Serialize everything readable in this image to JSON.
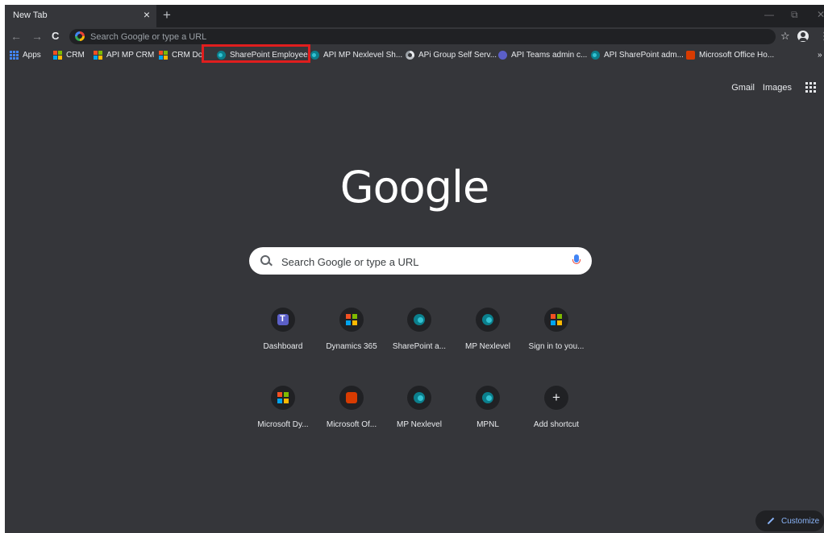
{
  "browser": {
    "tab_title": "New Tab",
    "tab_close": "×",
    "new_tab": "+",
    "nav": {
      "back": "←",
      "forward": "→",
      "reload": "C"
    },
    "omnibox_placeholder": "Search Google or type a URL",
    "star": "☆",
    "menu": "⋮",
    "window": {
      "minimize": "—",
      "restore": "⧉",
      "close": "✕"
    }
  },
  "bookmarks": {
    "items": [
      {
        "label": "Apps",
        "icon": "apps-grid-icon"
      },
      {
        "label": "CRM",
        "icon": "microsoft-icon"
      },
      {
        "label": "API MP CRM",
        "icon": "microsoft-icon"
      },
      {
        "label": "CRM Do",
        "icon": "microsoft-icon"
      },
      {
        "label": "SharePoint Employee",
        "icon": "sharepoint-icon"
      },
      {
        "label": "API MP Nexlevel Sh...",
        "icon": "sharepoint-icon"
      },
      {
        "label": "APi Group Self Serv...",
        "icon": "chrome-icon"
      },
      {
        "label": "API Teams admin c...",
        "icon": "teams-icon"
      },
      {
        "label": "API SharePoint adm...",
        "icon": "sharepoint-icon"
      },
      {
        "label": "Microsoft Office Ho...",
        "icon": "office-icon"
      }
    ],
    "more": "»"
  },
  "header_links": {
    "gmail": "Gmail",
    "images": "Images"
  },
  "logo": "Google",
  "search": {
    "placeholder": "Search Google or type a URL"
  },
  "shortcuts": [
    {
      "label": "Dashboard",
      "icon": "teams-icon"
    },
    {
      "label": "Dynamics 365",
      "icon": "microsoft-icon"
    },
    {
      "label": "SharePoint a...",
      "icon": "sharepoint-icon"
    },
    {
      "label": "MP Nexlevel",
      "icon": "sharepoint-icon"
    },
    {
      "label": "Sign in to you...",
      "icon": "microsoft-icon"
    },
    {
      "label": "Microsoft Dy...",
      "icon": "microsoft-icon"
    },
    {
      "label": "Microsoft Of...",
      "icon": "office-icon"
    },
    {
      "label": "MP Nexlevel",
      "icon": "sharepoint-icon"
    },
    {
      "label": "MPNL",
      "icon": "sharepoint-icon"
    },
    {
      "label": "Add shortcut",
      "icon": "plus-icon"
    }
  ],
  "customize": "Customize",
  "colors": {
    "background": "#35363a",
    "tabstrip": "#202124",
    "highlight": "#e01e1e",
    "accent": "#8ab4f8"
  }
}
